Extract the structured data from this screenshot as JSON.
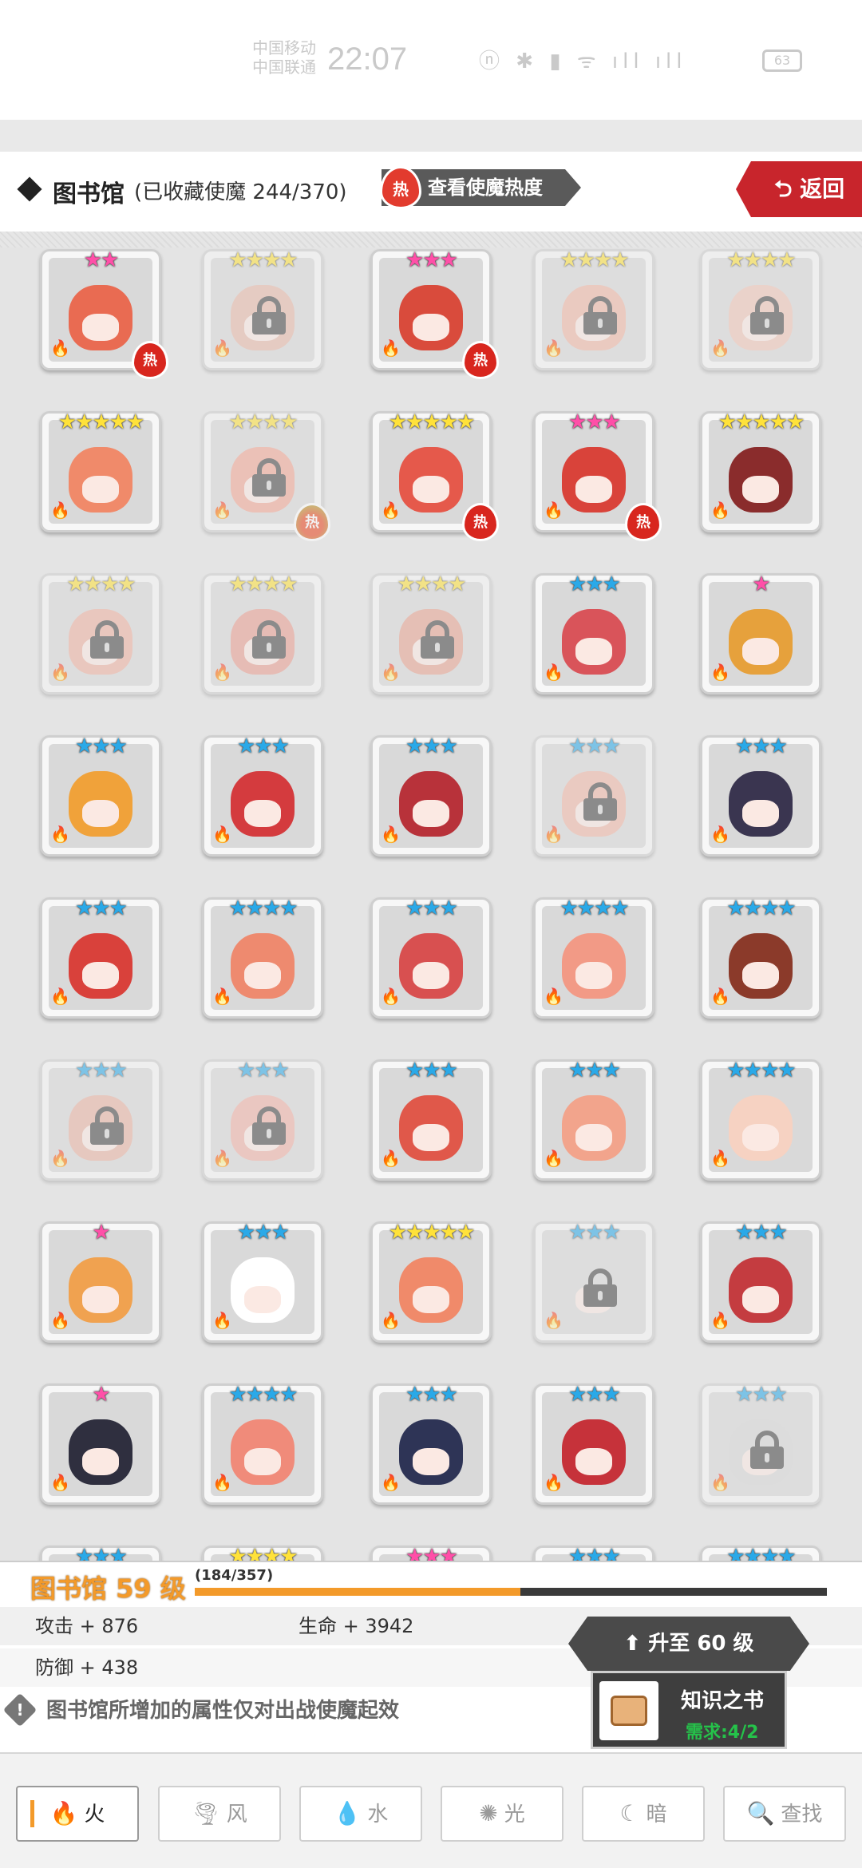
{
  "status_bar": {
    "carrier_1": "中国移动",
    "carrier_2": "中国联通",
    "time": "22:07",
    "right_icons": "ⓝ ✱ ▮ ᯤ ıll ıll",
    "battery": "63"
  },
  "header": {
    "title": "图书馆",
    "collection": "(已收藏使魔 244/370)",
    "hot_badge": "热",
    "hot_button": "查看使魔热度",
    "back_button": "⮌ 返回"
  },
  "colors": {
    "accent_orange": "#f39a2a",
    "red": "#c8252c",
    "fire": "#e03a25"
  },
  "grid": {
    "rows": [
      [
        {
          "locked": false,
          "stars": 2,
          "star_color": "pink",
          "hot": "热",
          "tint": "#e96b52"
        },
        {
          "locked": true,
          "stars": 4,
          "star_color": "yellow",
          "tint": "#e6b7a8"
        },
        {
          "locked": false,
          "stars": 3,
          "star_color": "pink",
          "hot": "热",
          "tint": "#d94b3c"
        },
        {
          "locked": true,
          "stars": 4,
          "star_color": "yellow",
          "tint": "#f0b5a3"
        },
        {
          "locked": true,
          "stars": 4,
          "star_color": "yellow",
          "tint": "#efc4b6"
        }
      ],
      [
        {
          "locked": false,
          "stars": 5,
          "star_color": "yellow",
          "tint": "#f08a6a"
        },
        {
          "locked": true,
          "stars": 4,
          "star_color": "yellow",
          "hot": "热",
          "hot_yellow": true,
          "tint": "#f1a594"
        },
        {
          "locked": false,
          "stars": 5,
          "star_color": "yellow",
          "hot": "热",
          "tint": "#e5594b"
        },
        {
          "locked": false,
          "stars": 3,
          "star_color": "pink",
          "hot": "热",
          "tint": "#d9433a"
        },
        {
          "locked": false,
          "stars": 5,
          "star_color": "yellow",
          "tint": "#8a2c2c"
        }
      ],
      [
        {
          "locked": true,
          "stars": 4,
          "star_color": "yellow",
          "tint": "#eeb0a0"
        },
        {
          "locked": true,
          "stars": 4,
          "star_color": "yellow",
          "tint": "#e89d8f"
        },
        {
          "locked": true,
          "stars": 4,
          "star_color": "yellow",
          "tint": "#e6a290"
        },
        {
          "locked": false,
          "stars": 3,
          "star_color": "blue",
          "tint": "#d9545a"
        },
        {
          "locked": false,
          "stars": 1,
          "star_color": "pink",
          "tint": "#e6a13c"
        }
      ],
      [
        {
          "locked": false,
          "stars": 3,
          "star_color": "blue",
          "tint": "#f0a23a"
        },
        {
          "locked": false,
          "stars": 3,
          "star_color": "blue",
          "tint": "#d43b3e"
        },
        {
          "locked": false,
          "stars": 3,
          "star_color": "blue",
          "tint": "#b8323a"
        },
        {
          "locked": true,
          "stars": 3,
          "star_color": "blue",
          "tint": "#f0b6a6"
        },
        {
          "locked": false,
          "stars": 3,
          "star_color": "blue",
          "tint": "#3a3550"
        }
      ],
      [
        {
          "locked": false,
          "stars": 3,
          "star_color": "blue",
          "tint": "#d9413b"
        },
        {
          "locked": false,
          "stars": 4,
          "star_color": "blue",
          "tint": "#ee8a6f"
        },
        {
          "locked": false,
          "stars": 3,
          "star_color": "blue",
          "tint": "#d85050"
        },
        {
          "locked": false,
          "stars": 4,
          "star_color": "blue",
          "tint": "#f29a86"
        },
        {
          "locked": false,
          "stars": 4,
          "star_color": "blue",
          "tint": "#8b3a2a"
        }
      ],
      [
        {
          "locked": true,
          "stars": 3,
          "star_color": "blue",
          "tint": "#e8b2a2"
        },
        {
          "locked": true,
          "stars": 3,
          "star_color": "blue",
          "tint": "#f0b0a5"
        },
        {
          "locked": false,
          "stars": 3,
          "star_color": "blue",
          "tint": "#e0584a"
        },
        {
          "locked": false,
          "stars": 3,
          "star_color": "blue",
          "tint": "#f2a48c"
        },
        {
          "locked": false,
          "stars": 4,
          "star_color": "blue",
          "tint": "#f6d2c2"
        }
      ],
      [
        {
          "locked": false,
          "stars": 1,
          "star_color": "pink",
          "tint": "#f0a250"
        },
        {
          "locked": false,
          "stars": 3,
          "star_color": "blue",
          "tint": "#ffffff"
        },
        {
          "locked": false,
          "stars": 5,
          "star_color": "yellow",
          "tint": "#f08a6a"
        },
        {
          "locked": true,
          "stars": 3,
          "star_color": "blue",
          "tint": "#d8d8d8"
        },
        {
          "locked": false,
          "stars": 3,
          "star_color": "blue",
          "tint": "#c43c40"
        }
      ],
      [
        {
          "locked": false,
          "stars": 1,
          "star_color": "pink",
          "tint": "#2f2f3f"
        },
        {
          "locked": false,
          "stars": 4,
          "star_color": "blue",
          "tint": "#f08b7a"
        },
        {
          "locked": false,
          "stars": 3,
          "star_color": "blue",
          "tint": "#2e3456"
        },
        {
          "locked": false,
          "stars": 3,
          "star_color": "blue",
          "tint": "#c6323a"
        },
        {
          "locked": true,
          "stars": 3,
          "star_color": "blue",
          "tint": "#d6d6d6"
        }
      ],
      [
        {
          "locked": false,
          "stars": 3,
          "star_color": "blue",
          "tint": "#e0e0e0"
        },
        {
          "locked": false,
          "stars": 4,
          "star_color": "yellow",
          "tint": "#e07060"
        },
        {
          "locked": false,
          "stars": 3,
          "star_color": "pink",
          "tint": "#d05050"
        },
        {
          "locked": false,
          "stars": 3,
          "star_color": "blue",
          "tint": "#c04040"
        },
        {
          "locked": false,
          "stars": 4,
          "star_color": "blue",
          "tint": "#d06060"
        }
      ]
    ]
  },
  "library": {
    "level_title": "图书馆 59 级",
    "progress_text": "(184/357)",
    "progress": 0.515,
    "attack": "攻击 + 876",
    "hp": "生命 + 3942",
    "defense": "防御 + 438",
    "info_text": "图书馆所增加的属性仅对出战使魔起效",
    "upgrade_button": "⬆ 升至 60 级",
    "book_name": "知识之书",
    "book_requirement": "需求:4/2"
  },
  "tabs": [
    {
      "icon": "fire-icon",
      "glyph": "🔥",
      "label": "火",
      "active": true
    },
    {
      "icon": "wind-icon",
      "glyph": "🌪",
      "label": "风",
      "active": false
    },
    {
      "icon": "water-icon",
      "glyph": "💧",
      "label": "水",
      "active": false
    },
    {
      "icon": "light-icon",
      "glyph": "✺",
      "label": "光",
      "active": false
    },
    {
      "icon": "dark-icon",
      "glyph": "☾",
      "label": "暗",
      "active": false
    },
    {
      "icon": "search-icon",
      "glyph": "🔍",
      "label": "查找",
      "active": false
    }
  ]
}
